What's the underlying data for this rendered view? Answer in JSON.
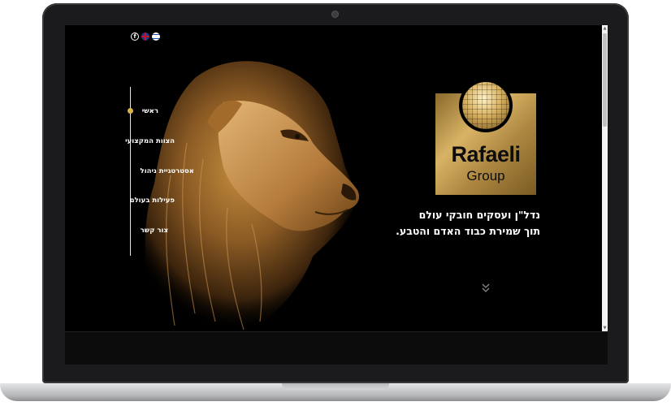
{
  "header": {
    "social_icons": [
      "facebook-icon",
      "uk-flag-icon",
      "israel-flag-icon"
    ],
    "facebook_glyph": "f"
  },
  "nav": {
    "items": [
      {
        "label": "ראשי",
        "active": true
      },
      {
        "label": "הצוות המקצועי",
        "active": false
      },
      {
        "label": "אסטרטגיית ניהול",
        "active": false
      },
      {
        "label": "פעילות בעולם",
        "active": false
      },
      {
        "label": "צור קשר",
        "active": false
      }
    ],
    "active_color": "#d9b24a"
  },
  "logo": {
    "title": "Rafaeli",
    "subtitle": "Group",
    "brand_color": "#c9a458"
  },
  "hero": {
    "tagline_line1": "נדל\"ן ועסקים חובקי עולם",
    "tagline_line2": "תוך שמירת כבוד האדם והטבע."
  },
  "icons": {
    "scroll_down": "chevron-double-down-icon"
  }
}
